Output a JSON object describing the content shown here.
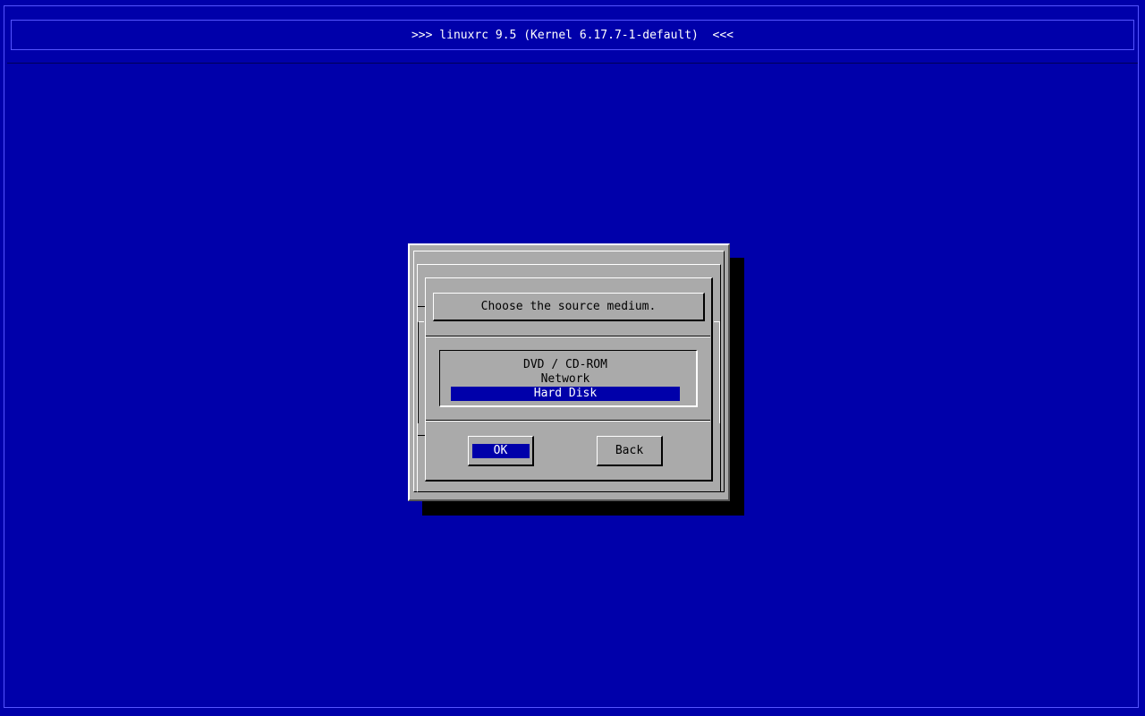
{
  "header": {
    "title": ">>> linuxrc 9.5 (Kernel 6.17.7-1-default)  <<<"
  },
  "dialog": {
    "prompt": "Choose the source medium.",
    "options": [
      {
        "label": "DVD / CD-ROM",
        "selected": false
      },
      {
        "label": "Network",
        "selected": false
      },
      {
        "label": "Hard Disk",
        "selected": true
      }
    ],
    "buttons": {
      "ok_label": "OK",
      "back_label": "Back"
    }
  },
  "colors": {
    "background": "#0000aa",
    "dialog": "#aaaaaa",
    "highlight": "#0000aa",
    "highlight_text": "#ffffff"
  }
}
